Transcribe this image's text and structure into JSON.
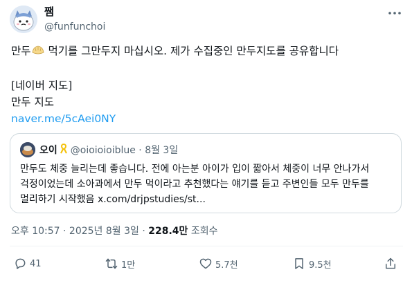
{
  "author": {
    "display_name": "쨈",
    "handle": "@funfunchoi",
    "avatar_icon": "sad-cat-avatar-icon"
  },
  "tweet": {
    "line1_before_emoji": "만두",
    "emoji_icon": "dumpling-emoji-icon",
    "line1_after_emoji": " 먹기를 그만두지 마십시오. 제가 수집중인 만두지도를 공유합니다",
    "line2": "[네이버 지도]",
    "line3": "만두 지도",
    "link": "naver.me/5cAei0NY"
  },
  "quote": {
    "name": "오이",
    "ribbon_icon": "yellow-ribbon-icon",
    "meta": "@oioioioiblue · 8월 3일",
    "lines": [
      "만두도 체중 늘리는데 좋습니다. 전에 아는분 아이가 입이 짧아서 체중이 너무 안나가서",
      "걱정이었는데 소아과에서 만두 먹이라고 추천했다는 얘기를 듣고 주변인들 모두 만두를",
      "멀리하기 시작했음 x.com/drjpstudies/st..."
    ]
  },
  "meta": {
    "timestamp": "오후 10:57 · 2025년 8월 3일 · ",
    "views": "228.4만",
    "views_label": " 조회수"
  },
  "actions": {
    "reply_count": "41",
    "retweet_count": "1만",
    "like_count": "5.7천",
    "bookmark_count": "9.5천"
  },
  "colors": {
    "link": "#1d9bf0",
    "secondary_text": "#536471",
    "border": "#cfd9de"
  }
}
